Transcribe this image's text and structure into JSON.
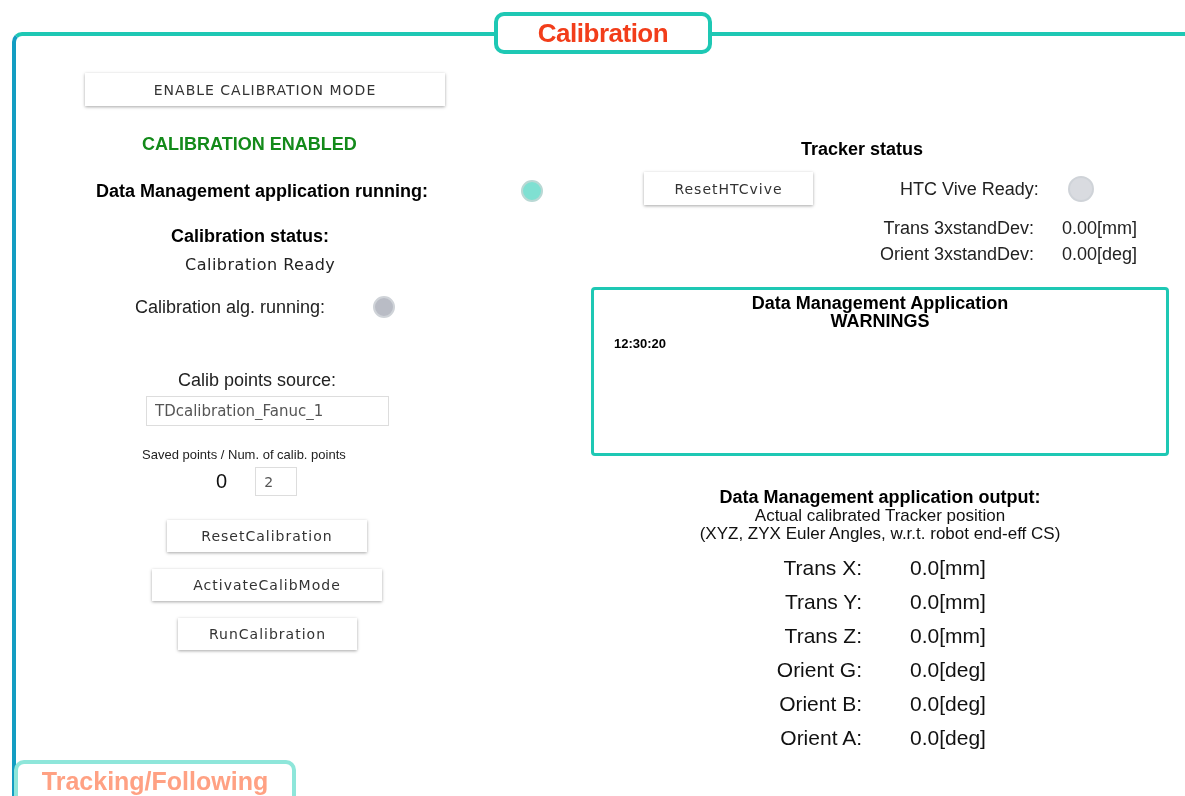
{
  "panel": {
    "title": "Calibration"
  },
  "left": {
    "mode_button": "ENABLE CALIBRATION MODE",
    "mode_status": "CALIBRATION ENABLED",
    "dm_running": {
      "label": "Data Management application running:",
      "on": true
    },
    "status_label": "Calibration status:",
    "status_value": "Calibration Ready",
    "alg_running": {
      "label": "Calibration  alg.  running:",
      "on": false
    },
    "source_label": "Calib points source:",
    "source_value": "TDcalibration_Fanuc_1",
    "points_label": "Saved points / Num. of calib. points",
    "saved_points": "0",
    "num_points": "2",
    "buttons": [
      "ResetCalibration",
      "ActivateCalibMode",
      "RunCalibration"
    ]
  },
  "right": {
    "tracker_title": "Tracker status",
    "reset_button": "ResetHTCvive",
    "vive_ready": {
      "label": "HTC Vive Ready:",
      "on": false
    },
    "stats": [
      {
        "label": "Trans 3xstandDev:",
        "value": "0.00[mm]"
      },
      {
        "label": "Orient 3xstandDev:",
        "value": "0.00[deg]"
      }
    ],
    "warnings": {
      "title": "Data Management Application",
      "subtitle": "WARNINGS",
      "entries": [
        "12:30:20"
      ]
    },
    "output": {
      "title": "Data Management application output:",
      "lines": [
        "Actual calibrated Tracker position",
        "(XYZ, ZYX Euler Angles, w.r.t. robot end-eff CS)"
      ],
      "values": [
        {
          "label": "Trans X:",
          "value": "0.0[mm]"
        },
        {
          "label": "Trans Y:",
          "value": "0.0[mm]"
        },
        {
          "label": "Trans Z:",
          "value": "0.0[mm]"
        },
        {
          "label": "Orient G:",
          "value": "0.0[deg]"
        },
        {
          "label": "Orient B:",
          "value": "0.0[deg]"
        },
        {
          "label": "Orient A:",
          "value": "0.0[deg]"
        }
      ]
    }
  },
  "next_section": {
    "title": "Tracking/Following"
  }
}
